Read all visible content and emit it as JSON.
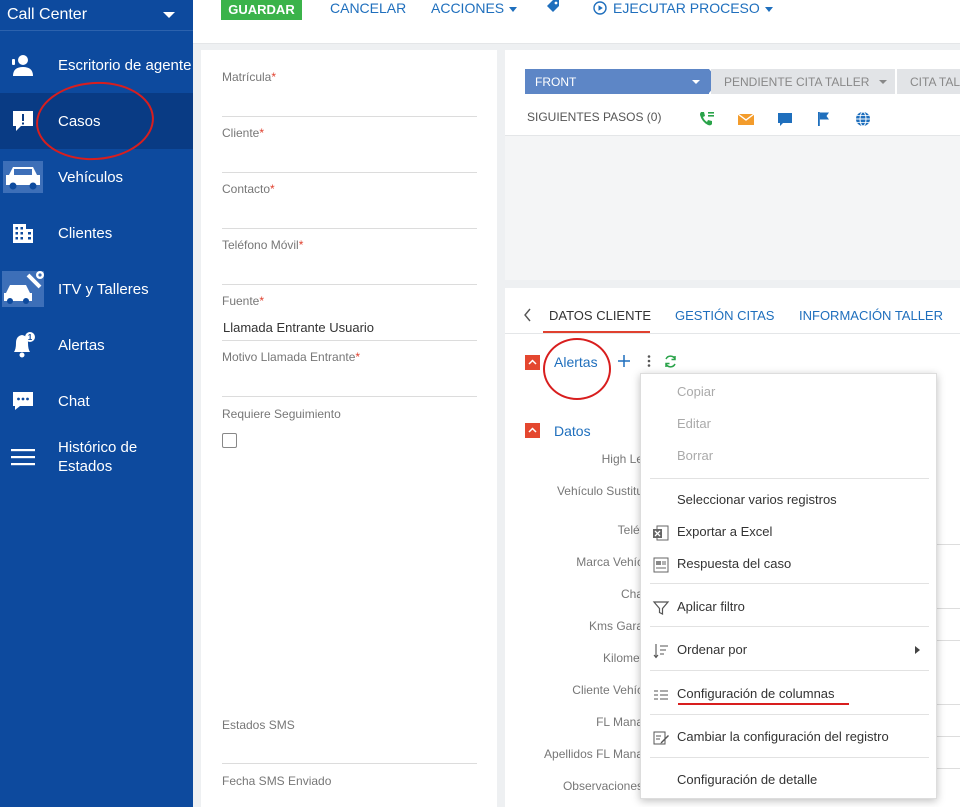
{
  "sidebar": {
    "title": "Call Center",
    "items": [
      {
        "label": "Escritorio de agente",
        "icon": "agent-icon"
      },
      {
        "label": "Casos",
        "icon": "alert-case-icon"
      },
      {
        "label": "Vehículos",
        "icon": "car-icon"
      },
      {
        "label": "Clientes",
        "icon": "building-icon"
      },
      {
        "label": "ITV y Talleres",
        "icon": "workshop-icon"
      },
      {
        "label": "Alertas",
        "icon": "bell-icon"
      },
      {
        "label": "Chat",
        "icon": "chat-icon"
      },
      {
        "label": "Histórico de Estados",
        "icon": "menu-lines-icon"
      }
    ]
  },
  "toolbar": {
    "save": "GUARDAR",
    "cancel": "CANCELAR",
    "actions": "ACCIONES",
    "run_process": "EJECUTAR PROCESO"
  },
  "form": {
    "matricula": "Matrícula",
    "cliente": "Cliente",
    "contacto": "Contacto",
    "telefono": "Teléfono Móvil",
    "fuente": "Fuente",
    "fuente_value": "Llamada Entrante Usuario",
    "motivo": "Motivo Llamada Entrante",
    "requiere": "Requiere Seguimiento",
    "estados_sms": "Estados SMS",
    "fecha_sms": "Fecha SMS Enviado",
    "required_mark": "*"
  },
  "stages": {
    "front": "FRONT",
    "pendiente": "PENDIENTE CITA TALLER",
    "cita": "CITA TALL",
    "next_steps": "SIGUIENTES PASOS (0)"
  },
  "detail": {
    "tabs": [
      "DATOS CLIENTE",
      "GESTIÓN CITAS",
      "INFORMACIÓN TALLER"
    ],
    "alertas": "Alertas",
    "datos": "Datos",
    "labels": [
      "High Le",
      "Vehículo Sustitu",
      "Teléf",
      "Marca Vehíc",
      "Cha",
      "Kms Gara",
      "Kilomet",
      "Cliente Vehíc",
      "FL Mana",
      "Apellidos FL Mana",
      "Observaciones"
    ]
  },
  "menu": {
    "copiar": "Copiar",
    "editar": "Editar",
    "borrar": "Borrar",
    "seleccionar": "Seleccionar varios registros",
    "exportar": "Exportar a Excel",
    "respuesta": "Respuesta del caso",
    "filtro": "Aplicar filtro",
    "ordenar": "Ordenar por",
    "columnas": "Configuración de columnas",
    "cambiar": "Cambiar la configuración del registro",
    "detalle": "Configuración de detalle"
  },
  "colors": {
    "sidebar": "#0d4a9e",
    "sidebar_active": "#093b84",
    "save_button": "#3bb34a",
    "accent": "#e0412f",
    "link": "#1f6fbd",
    "annotation": "#d81e1e"
  }
}
